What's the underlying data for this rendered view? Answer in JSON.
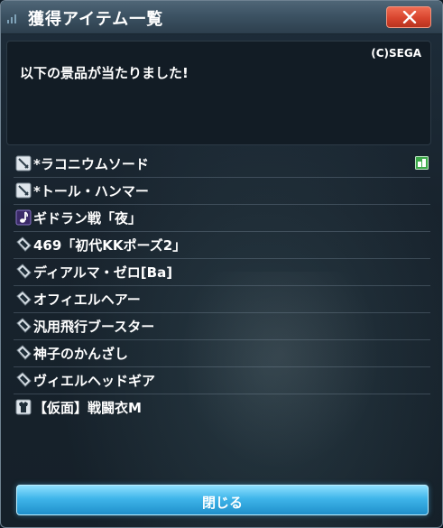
{
  "dialog": {
    "title": "獲得アイテム一覧",
    "copyright": "(C)SEGA",
    "message": "以下の景品が当たりました!",
    "close_button_label": "閉じる"
  },
  "items": [
    {
      "label": "*ラコニウムソード",
      "icon": "sword-weapon-icon",
      "new": true
    },
    {
      "label": "*トール・ハンマー",
      "icon": "sword-weapon-icon",
      "new": false
    },
    {
      "label": "ギドラン戦「夜」",
      "icon": "music-note-icon",
      "new": false
    },
    {
      "label": "469「初代KKポーズ2」",
      "icon": "tag-item-icon",
      "new": false
    },
    {
      "label": "ディアルマ・ゼロ[Ba]",
      "icon": "tag-item-icon",
      "new": false
    },
    {
      "label": "オフィエルヘアー",
      "icon": "tag-item-icon",
      "new": false
    },
    {
      "label": "汎用飛行ブースター",
      "icon": "tag-item-icon",
      "new": false
    },
    {
      "label": "神子のかんざし",
      "icon": "tag-item-icon",
      "new": false
    },
    {
      "label": "ヴィエルヘッドギア",
      "icon": "tag-item-icon",
      "new": false
    },
    {
      "label": "【仮面】戦闘衣M",
      "icon": "costume-icon",
      "new": false
    }
  ],
  "colors": {
    "close_x_button": "#d8452e",
    "primary_button": "#3fb5ea",
    "new_badge": "#3da84a"
  }
}
